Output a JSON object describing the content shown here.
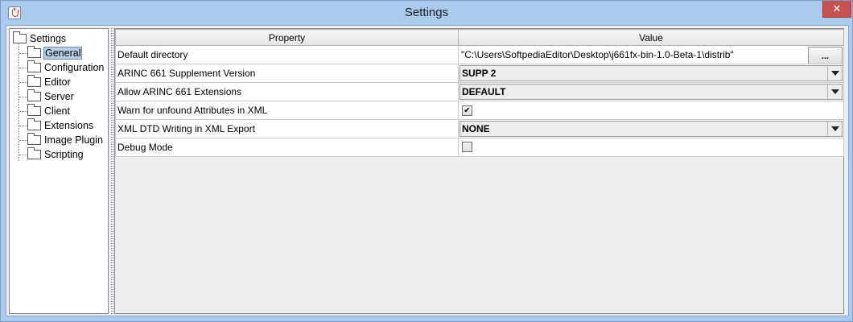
{
  "window": {
    "title": "Settings"
  },
  "tree": {
    "root": "Settings",
    "items": [
      {
        "label": "General",
        "selected": true
      },
      {
        "label": "Configuration",
        "selected": false
      },
      {
        "label": "Editor",
        "selected": false
      },
      {
        "label": "Server",
        "selected": false
      },
      {
        "label": "Client",
        "selected": false
      },
      {
        "label": "Extensions",
        "selected": false
      },
      {
        "label": "Image Plugin",
        "selected": false
      },
      {
        "label": "Scripting",
        "selected": false
      }
    ]
  },
  "table": {
    "headers": [
      "Property",
      "Value"
    ],
    "rows": [
      {
        "property": "Default directory",
        "type": "text",
        "value": "\"C:\\Users\\SoftpediaEditor\\Desktop\\j661fx-bin-1.0-Beta-1\\distrib\"",
        "button": "..."
      },
      {
        "property": "ARINC 661 Supplement Version",
        "type": "combo",
        "value": "SUPP 2"
      },
      {
        "property": "Allow ARINC 661 Extensions",
        "type": "combo",
        "value": "DEFAULT"
      },
      {
        "property": "Warn for unfound Attributes in XML",
        "type": "checkbox",
        "checked": true
      },
      {
        "property": "XML DTD Writing in XML Export",
        "type": "combo",
        "value": "NONE"
      },
      {
        "property": "Debug Mode",
        "type": "checkbox",
        "checked": false
      }
    ]
  },
  "colors": {
    "titlebar": "#aacbee",
    "close": "#c75050",
    "selection": "#b8cfe5"
  },
  "icons": {
    "app": "java-icon",
    "folder": "folder-icon",
    "close": "close-icon",
    "dropdown": "chevron-down-icon",
    "check": "checkmark-icon"
  }
}
